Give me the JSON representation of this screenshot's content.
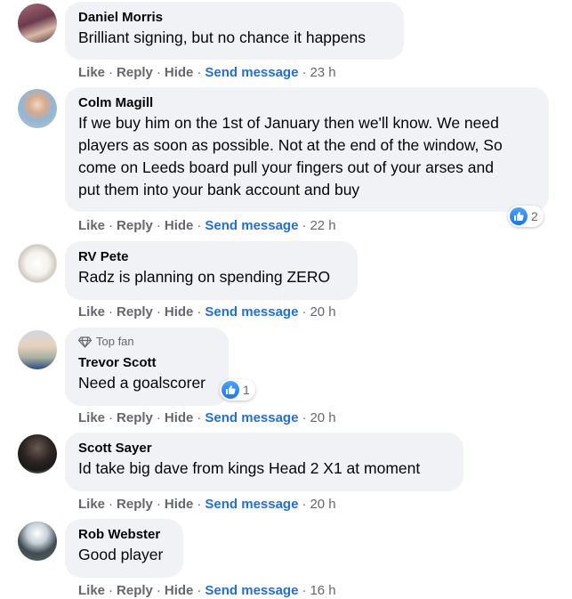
{
  "actions": {
    "like": "Like",
    "reply": "Reply",
    "hide": "Hide",
    "send": "Send message",
    "sep": "·"
  },
  "colors": {
    "bubble": "#f0f2f5",
    "link": "#216fdb",
    "muted": "#65676b",
    "like": "#1877f2"
  },
  "comments": [
    {
      "name": "Daniel Morris",
      "lines": [
        "Brilliant signing, but no chance it happens"
      ],
      "time": "23 h"
    },
    {
      "name": "Colm Magill",
      "lines": [
        "If we buy him on the 1st of January then we'll know. We need",
        "players as soon as possible. Not at the end of the window, So",
        "come on Leeds board pull your fingers out of your arses and",
        "put them into your bank account and buy"
      ],
      "time": "22 h",
      "reactions": "2"
    },
    {
      "name": "RV Pete",
      "lines": [
        "Radz is planning on spending ZERO"
      ],
      "time": "20 h"
    },
    {
      "name": "Trevor Scott",
      "badge": "Top fan",
      "lines": [
        "Need a goalscorer"
      ],
      "time": "20 h",
      "reactions": "1"
    },
    {
      "name": "Scott Sayer",
      "lines": [
        "Id take big dave from kings Head 2 X1 at moment"
      ],
      "time": "20 h"
    },
    {
      "name": "Rob Webster",
      "lines": [
        "Good player"
      ],
      "time": "16 h"
    }
  ]
}
